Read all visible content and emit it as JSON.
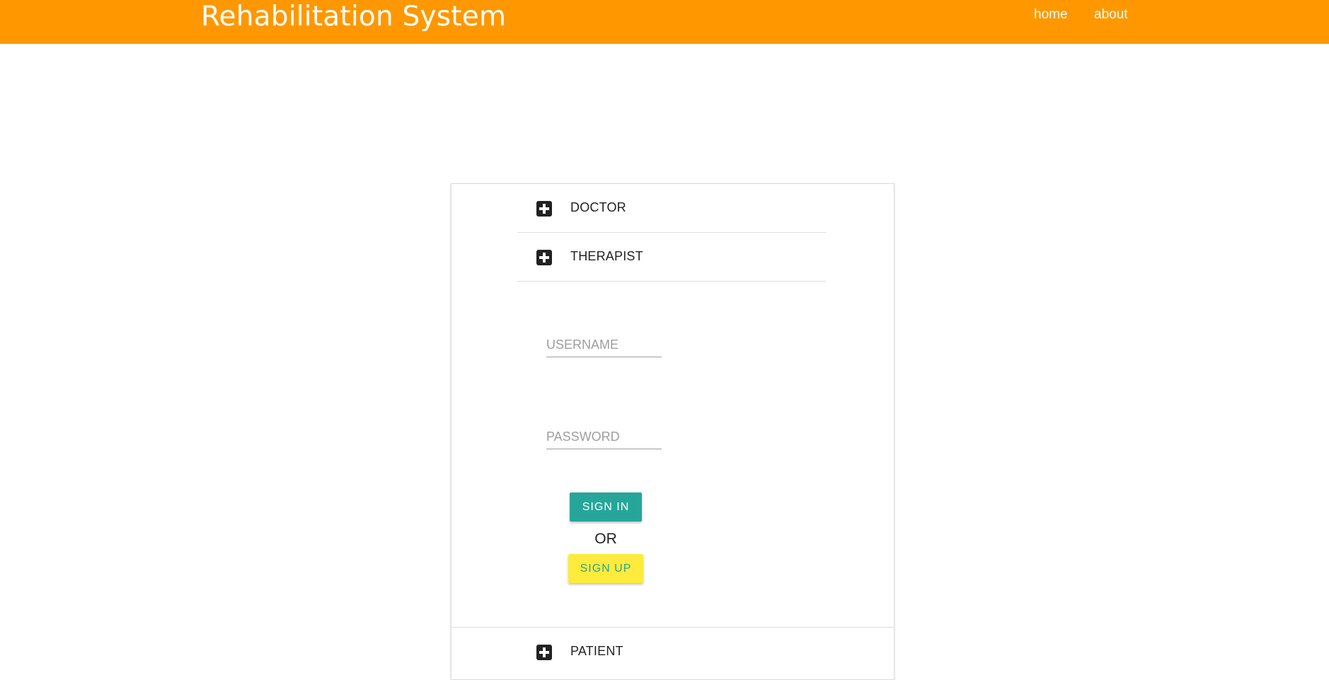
{
  "header": {
    "brand": "Rehabilitation System",
    "nav": {
      "home": "home",
      "about": "about"
    },
    "color": "#ff9800"
  },
  "roles": {
    "doctor": {
      "label": "DOCTOR",
      "icon": "medical-cross-icon"
    },
    "therapist": {
      "label": "THERAPIST",
      "icon": "medical-cross-icon"
    },
    "patient": {
      "label": "PATIENT",
      "icon": "medical-cross-icon"
    }
  },
  "login": {
    "username_placeholder": "USERNAME",
    "username_value": "",
    "password_placeholder": "PASSWORD",
    "password_value": "",
    "signin_label": "SIGN IN",
    "or_label": "OR",
    "signup_label": "SIGN UP"
  },
  "colors": {
    "signin_bg": "#26a69a",
    "signup_bg": "#ffeb3b",
    "signup_text": "#26a69a"
  }
}
